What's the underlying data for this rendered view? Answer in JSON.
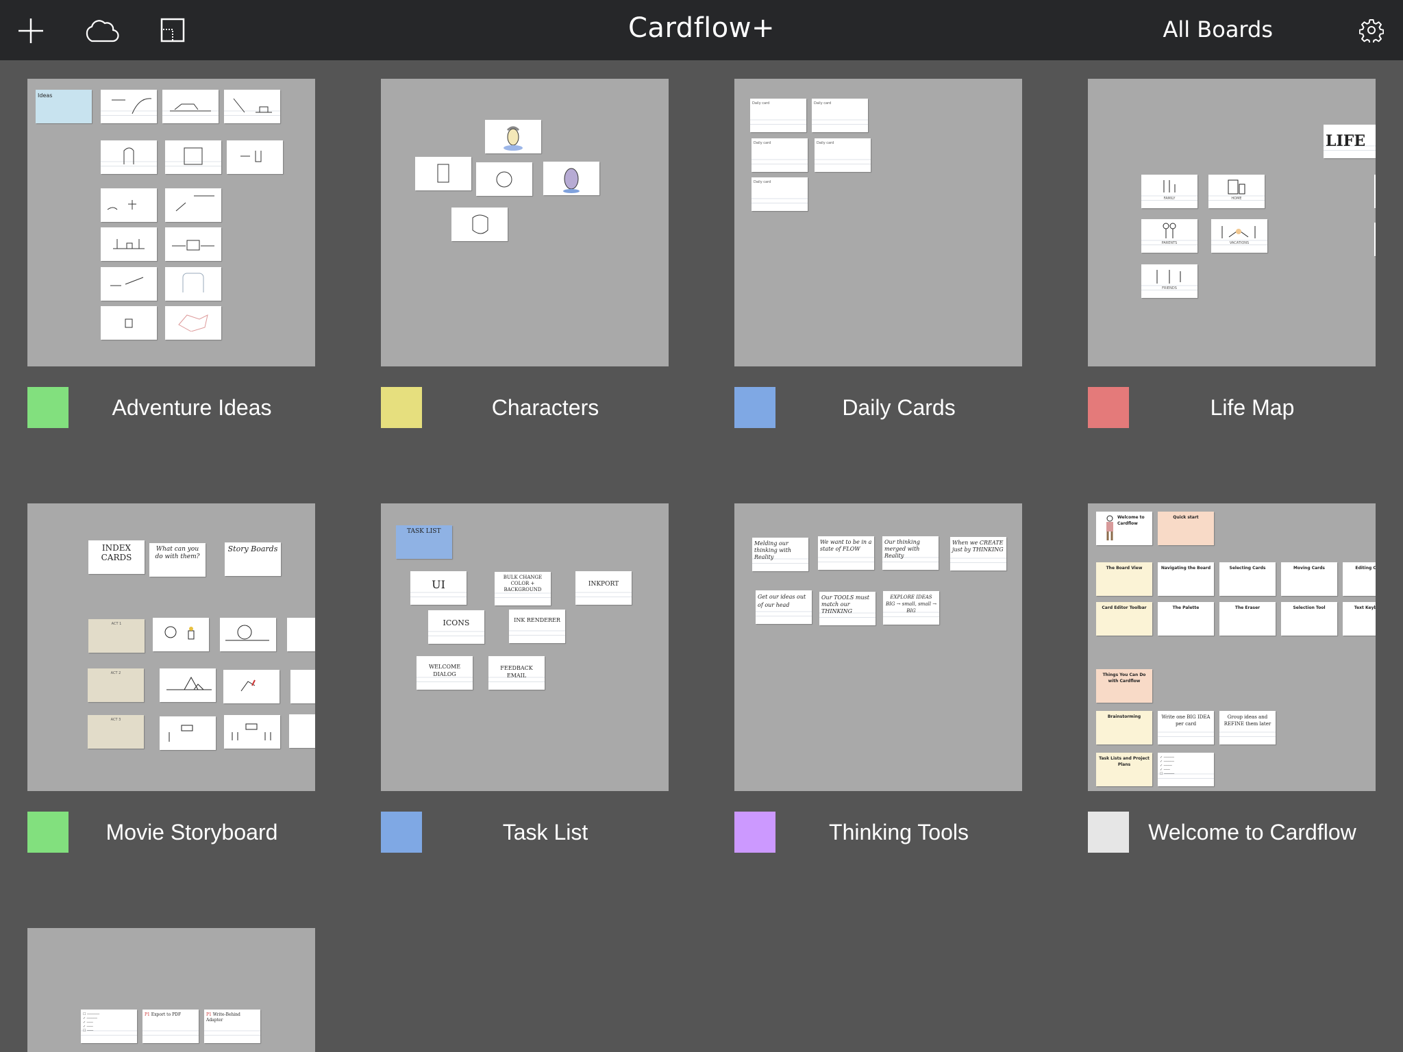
{
  "header": {
    "title": "Cardflow+",
    "all_boards_label": "All Boards",
    "icons": [
      "plus-icon",
      "cloud-icon",
      "layout-icon",
      "gear-icon"
    ]
  },
  "boards": [
    {
      "name": "Adventure Ideas",
      "color": "#82e07e",
      "cards": [
        "Ideas",
        "",
        "",
        "",
        "",
        "",
        "",
        "",
        "",
        "",
        "",
        "",
        "",
        ""
      ]
    },
    {
      "name": "Characters",
      "color": "#e6df7e",
      "cards": [
        "",
        "",
        "",
        "",
        ""
      ]
    },
    {
      "name": "Daily Cards",
      "color": "#7fa8e4",
      "cards": [
        "Daily card",
        "Daily card",
        "Daily card",
        "Daily card",
        "Daily card"
      ]
    },
    {
      "name": "Life Map",
      "color": "#e47a7a",
      "cards": [
        "LIFE",
        "FAMILY",
        "HOME",
        "PARENTS",
        "VACATIONS",
        "FRIENDS"
      ]
    },
    {
      "name": "Movie Storyboard",
      "color": "#82e07e",
      "cards": [
        "INDEX CARDS",
        "What can you do with them?",
        "Story Boards",
        "ACT 1",
        "ACT 2",
        "ACT 3"
      ]
    },
    {
      "name": "Task List",
      "color": "#7fa8e4",
      "cards": [
        "TASK LIST",
        "UI",
        "BULK CHANGE COLOR + BACKGROUND",
        "INKPORT",
        "ICONS",
        "INK RENDERER",
        "WELCOME DIALOG",
        "FEEDBACK EMAIL"
      ]
    },
    {
      "name": "Thinking Tools",
      "color": "#cc99ff",
      "cards": [
        "Melding our thinking with Reality",
        "We want to be in a state of FLOW",
        "Our thinking merged with Reality",
        "When we CREATE just by THINKING",
        "Get our ideas out of our head",
        "Our TOOLS must match our THINKING",
        "EXPLORE IDEAS BIG → small, small → BIG"
      ]
    },
    {
      "name": "Welcome to Cardflow",
      "color": "#e6e6e6",
      "cards": [
        "Welcome to Cardflow",
        "Quick start",
        "The Board View",
        "Navigating the Board",
        "Selecting Cards",
        "Moving Cards",
        "Editing Cards",
        "Card Editor Toolbar",
        "The Palette",
        "The Eraser",
        "Selection Tool",
        "Text Keyboard",
        "Things You Can Do with Cardflow",
        "Brainstorming",
        "Write one BIG IDEA per card",
        "Group ideas and REFINE them later",
        "Task Lists and Project Plans",
        ""
      ]
    },
    {
      "name": "",
      "color": "",
      "cards": [
        "",
        "Export to PDF",
        "Write-Behind Adapter"
      ]
    }
  ]
}
